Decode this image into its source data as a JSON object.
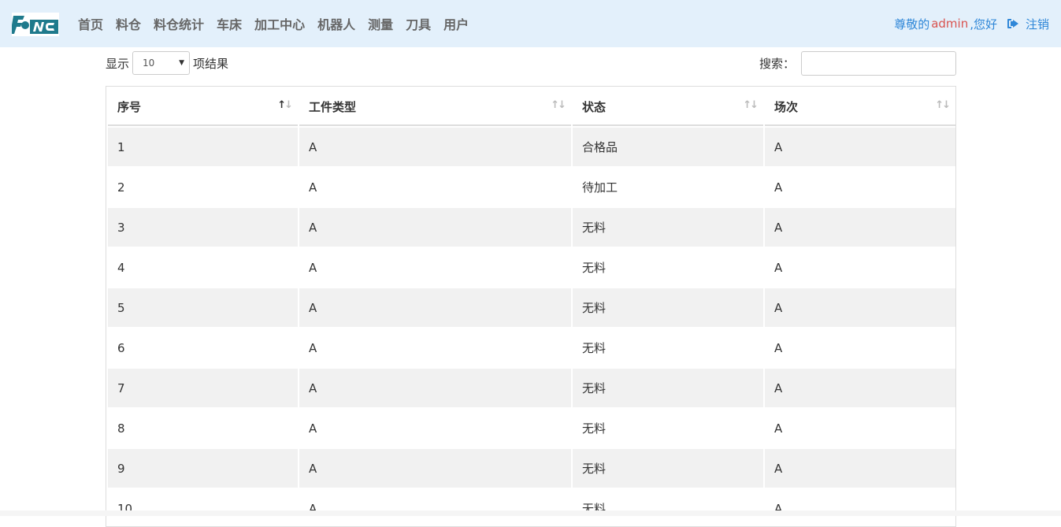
{
  "nav": {
    "items": [
      "首页",
      "料仓",
      "料仓统计",
      "车床",
      "加工中心",
      "机器人",
      "测量",
      "刀具",
      "用户"
    ]
  },
  "user": {
    "greeting": "尊敬的",
    "name": "admin",
    "suffix": ",您好",
    "logout_label": "注销"
  },
  "controls": {
    "show_label": "显示",
    "page_size": "10",
    "results_label": "项结果",
    "search_label": "搜索："
  },
  "table": {
    "columns": [
      "序号",
      "工件类型",
      "状态",
      "场次"
    ],
    "rows": [
      [
        "1",
        "A",
        "合格品",
        "A"
      ],
      [
        "2",
        "A",
        "待加工",
        "A"
      ],
      [
        "3",
        "A",
        "无料",
        "A"
      ],
      [
        "4",
        "A",
        "无料",
        "A"
      ],
      [
        "5",
        "A",
        "无料",
        "A"
      ],
      [
        "6",
        "A",
        "无料",
        "A"
      ],
      [
        "7",
        "A",
        "无料",
        "A"
      ],
      [
        "8",
        "A",
        "无料",
        "A"
      ],
      [
        "9",
        "A",
        "无料",
        "A"
      ],
      [
        "10",
        "A",
        "无料",
        "A"
      ]
    ]
  },
  "colors": {
    "navbar_bg": "#e3f0fb",
    "brand": "#1f7a8c",
    "link": "#2f87d8",
    "username": "#d9534f",
    "stripe": "#f1f1f1"
  }
}
